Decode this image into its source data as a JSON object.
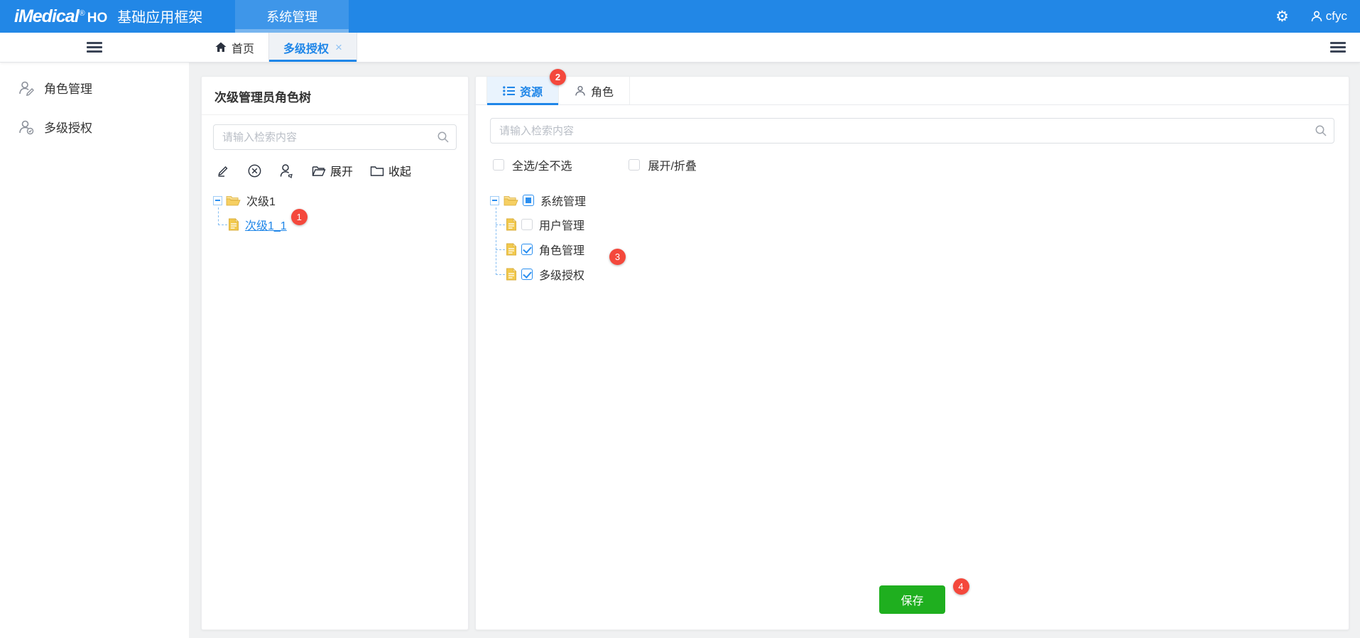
{
  "colors": {
    "header_blue": "#2287e6",
    "accent_blue": "#1f86e8",
    "badge_red": "#f4483c",
    "save_green": "#1faf1f",
    "folder_yellow": "#f6cf62"
  },
  "header": {
    "brand": {
      "logo": "iMedical",
      "reg": "®",
      "ho": "HO",
      "product": "基础应用框架"
    },
    "menu": [
      {
        "label": "系统管理",
        "active": true
      }
    ],
    "gear_glyph": "⚙",
    "user": "cfyc"
  },
  "tabbar": {
    "home_label": "首页",
    "tabs": [
      {
        "label": "多级授权",
        "active": true,
        "close_glyph": "×"
      }
    ]
  },
  "sidebar": {
    "items": [
      {
        "label": "角色管理",
        "icon": "role-manage-icon"
      },
      {
        "label": "多级授权",
        "icon": "multi-auth-icon"
      }
    ]
  },
  "left_panel": {
    "title": "次级管理员角色树",
    "search_placeholder": "请输入检索内容",
    "toolbar": {
      "icons": [
        "edit-icon",
        "delete-icon",
        "assign-user-icon"
      ],
      "expand_label": "展开",
      "collapse_label": "收起"
    },
    "tree": {
      "root_label": "次级1",
      "child_label": "次级1_1",
      "child_selected": true,
      "child_badge": "1"
    }
  },
  "right_panel": {
    "tabs": [
      {
        "label": "资源",
        "active": true,
        "badge": "2",
        "icon": "list-icon"
      },
      {
        "label": "角色",
        "active": false,
        "icon": "person-icon"
      }
    ],
    "search_placeholder": "请输入检索内容",
    "checkboxes": [
      {
        "label": "全选/全不选",
        "checked": false
      },
      {
        "label": "展开/折叠",
        "checked": false
      }
    ],
    "tree": {
      "root": {
        "label": "系统管理",
        "state": "indeterminate"
      },
      "children": [
        {
          "label": "用户管理",
          "checked": false
        },
        {
          "label": "角色管理",
          "checked": true,
          "badge": "3"
        },
        {
          "label": "多级授权",
          "checked": true
        }
      ]
    },
    "save_label": "保存",
    "save_badge": "4"
  }
}
